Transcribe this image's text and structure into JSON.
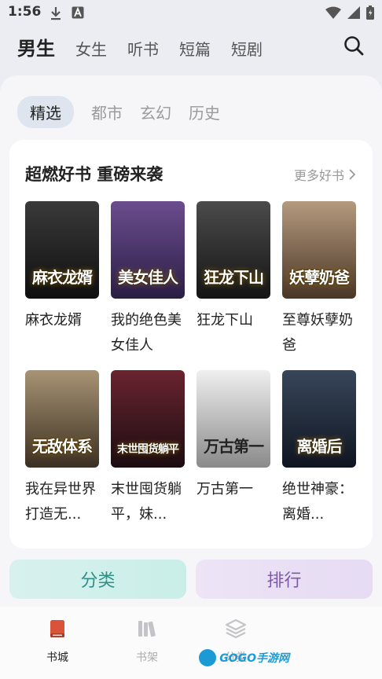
{
  "status_bar": {
    "time": "1:56",
    "icons": [
      "download-icon",
      "a-icon",
      "wifi-icon",
      "signal-icon",
      "battery-icon"
    ]
  },
  "top_tabs": [
    "男生",
    "女生",
    "听书",
    "短篇",
    "短剧"
  ],
  "sub_tabs": [
    "精选",
    "都市",
    "玄幻",
    "历史"
  ],
  "card": {
    "title": "超燃好书 重磅来袭",
    "more": "更多好书"
  },
  "books": [
    {
      "title": "麻衣龙婿",
      "cover_text": "麻衣龙婿",
      "cover_colors": [
        "#3a3a3a",
        "#0e0e0e"
      ]
    },
    {
      "title": "我的绝色美女佳人",
      "cover_text": "美女佳人",
      "cover_colors": [
        "#6b4d8e",
        "#2a1e44"
      ]
    },
    {
      "title": "狂龙下山",
      "cover_text": "狂龙下山",
      "cover_colors": [
        "#4b4b4b",
        "#141414"
      ]
    },
    {
      "title": "至尊妖孽奶爸",
      "cover_text": "妖孽奶爸",
      "cover_colors": [
        "#b49a7e",
        "#4a3626"
      ]
    },
    {
      "title": "我在异世界打造无...",
      "cover_text": "无敌体系",
      "cover_colors": [
        "#a89474",
        "#3b2f22"
      ]
    },
    {
      "title": "末世囤货躺平，妹...",
      "cover_text": "末世囤货躺平",
      "cover_colors": [
        "#6a2430",
        "#1a0c10"
      ]
    },
    {
      "title": "万古第一",
      "cover_text": "万古第一",
      "cover_colors": [
        "#efefef",
        "#8a8a8a"
      ]
    },
    {
      "title": "绝世神豪：离婚...",
      "cover_text": "离婚后",
      "cover_colors": [
        "#38465a",
        "#0f1520"
      ]
    }
  ],
  "feature_buttons": {
    "left": "分类",
    "right": "排行"
  },
  "bottom_nav": [
    {
      "label": "书城",
      "icon": "book-icon",
      "active": true
    },
    {
      "label": "书架",
      "icon": "bookshelf-icon",
      "active": false
    },
    {
      "label": "分类",
      "icon": "layers-icon",
      "active": false
    }
  ],
  "watermark": "GOGO手游网"
}
